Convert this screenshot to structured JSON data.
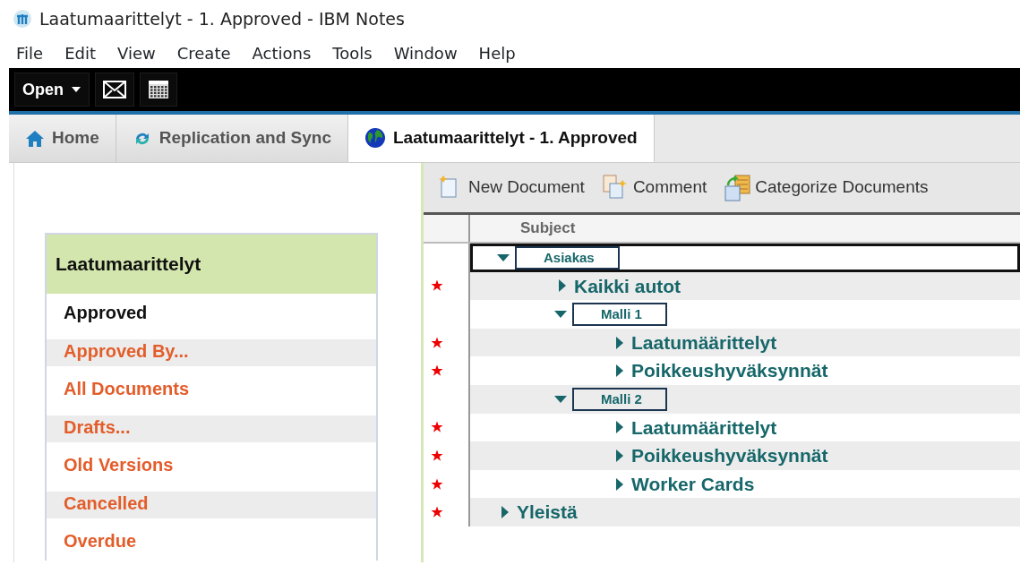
{
  "window": {
    "title": "Laatumaarittelyt - 1. Approved - IBM Notes"
  },
  "menu": [
    "File",
    "Edit",
    "View",
    "Create",
    "Actions",
    "Tools",
    "Window",
    "Help"
  ],
  "toolbar": {
    "open_label": "Open"
  },
  "tabs": [
    {
      "label": "Home",
      "selected": false
    },
    {
      "label": "Replication and Sync",
      "selected": false
    },
    {
      "label": "Laatumaarittelyt - 1. Approved",
      "selected": true
    }
  ],
  "navigator": {
    "title": "Laatumaarittelyt",
    "items": [
      {
        "label": "Approved",
        "selected": true
      },
      {
        "label": "Approved By...",
        "selected": false
      },
      {
        "label": "All Documents",
        "selected": false
      },
      {
        "label": "Drafts...",
        "selected": false
      },
      {
        "label": "Old Versions",
        "selected": false
      },
      {
        "label": "Cancelled",
        "selected": false
      },
      {
        "label": "Overdue",
        "selected": false
      }
    ]
  },
  "actions": [
    {
      "label": "New Document"
    },
    {
      "label": "Comment"
    },
    {
      "label": "Categorize Documents"
    }
  ],
  "view": {
    "column": "Subject",
    "rows": [
      {
        "label": "Asiakas",
        "expanded": true,
        "unread": false,
        "boxed": true,
        "selected": true,
        "children": [
          {
            "label": "Kaikki autot",
            "expanded": false,
            "unread": true,
            "boxed": false,
            "selected": false
          },
          {
            "label": "Malli 1",
            "expanded": true,
            "unread": false,
            "boxed": true,
            "selected": false,
            "children": [
              {
                "label": "Laatumäärittelyt",
                "expanded": false,
                "unread": true,
                "boxed": false,
                "selected": false
              },
              {
                "label": "Poikkeushyväksynnät",
                "expanded": false,
                "unread": true,
                "boxed": false,
                "selected": false
              }
            ]
          },
          {
            "label": "Malli 2",
            "expanded": true,
            "unread": false,
            "boxed": true,
            "selected": false,
            "children": [
              {
                "label": "Laatumäärittelyt",
                "expanded": false,
                "unread": true,
                "boxed": false,
                "selected": false
              },
              {
                "label": "Poikkeushyväksynnät",
                "expanded": false,
                "unread": true,
                "boxed": false,
                "selected": false
              },
              {
                "label": "Worker Cards",
                "expanded": false,
                "unread": true,
                "boxed": false,
                "selected": false
              }
            ]
          }
        ]
      },
      {
        "label": "Yleistä",
        "expanded": false,
        "unread": true,
        "boxed": false,
        "selected": false
      }
    ]
  }
}
